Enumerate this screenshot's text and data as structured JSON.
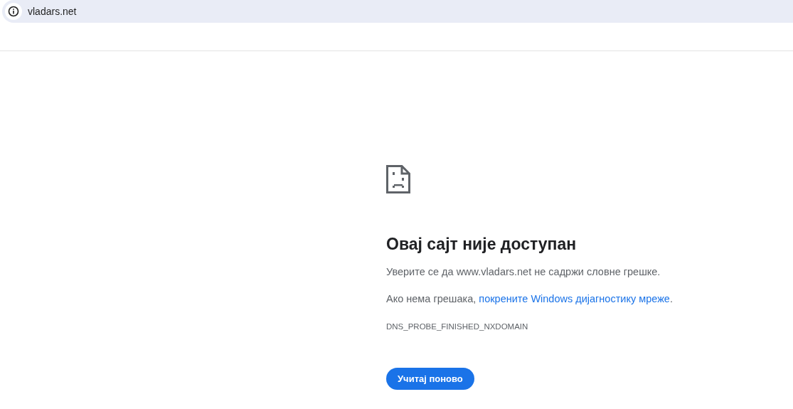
{
  "address_bar": {
    "url": "vladars.net"
  },
  "error": {
    "title": "Овај сајт није доступан",
    "message": "Уверите се да www.vladars.net не садржи словне грешке.",
    "hint": {
      "before": "Ако нема грешака, ",
      "link": "покрените Windows дијагностику мреже",
      "after": "."
    },
    "code": "DNS_PROBE_FINISHED_NXDOMAIN",
    "button": "Учитај поново"
  }
}
